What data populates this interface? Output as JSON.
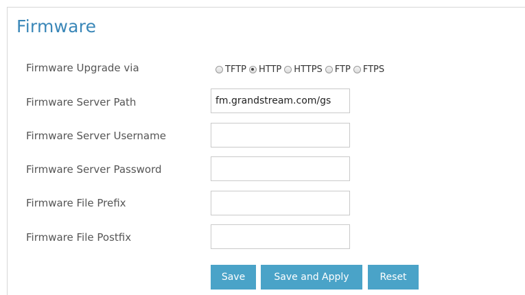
{
  "section": {
    "title": "Firmware"
  },
  "upgrade_via": {
    "label": "Firmware Upgrade via",
    "options": [
      {
        "label": "TFTP",
        "checked": false
      },
      {
        "label": "HTTP",
        "checked": true
      },
      {
        "label": "HTTPS",
        "checked": false
      },
      {
        "label": "FTP",
        "checked": false
      },
      {
        "label": "FTPS",
        "checked": false
      }
    ]
  },
  "fields": {
    "server_path": {
      "label": "Firmware Server Path",
      "value": "fm.grandstream.com/gs"
    },
    "server_username": {
      "label": "Firmware Server Username",
      "value": ""
    },
    "server_password": {
      "label": "Firmware Server Password",
      "value": ""
    },
    "file_prefix": {
      "label": "Firmware File Prefix",
      "value": ""
    },
    "file_postfix": {
      "label": "Firmware File Postfix",
      "value": ""
    }
  },
  "buttons": {
    "save": "Save",
    "save_apply": "Save and Apply",
    "reset": "Reset"
  }
}
